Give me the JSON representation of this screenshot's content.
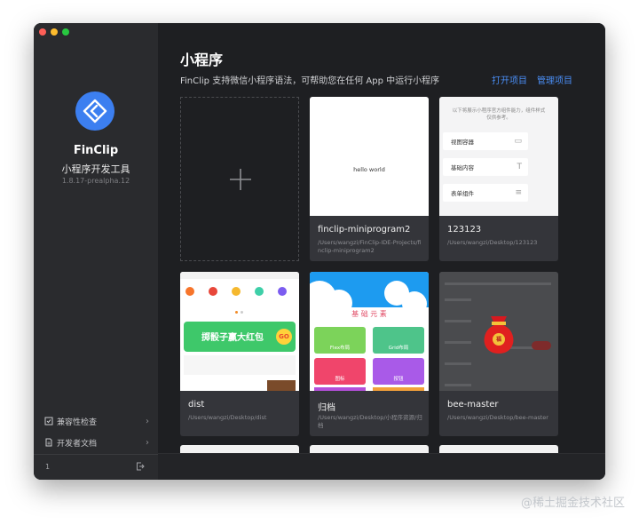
{
  "sidebar": {
    "app_name": "FinClip",
    "app_subtitle": "小程序开发工具",
    "version": "1.8.17-prealpha.12",
    "links": [
      {
        "label": "兼容性检查"
      },
      {
        "label": "开发者文档"
      }
    ],
    "footer_number": "1"
  },
  "header": {
    "title": "小程序",
    "description": "FinClip 支持微信小程序语法，可帮助您在任何 App 中运行小程序",
    "open_project": "打开项目",
    "manage_projects": "管理项目"
  },
  "projects": [
    {
      "name": "finclip-miniprogram2",
      "path": "/Users/wangzi/FinClip-IDE-Projects/finclip-miniprogram2",
      "preview_text": "hello world"
    },
    {
      "name": "123123",
      "path": "/Users/wangzi/Desktop/123123",
      "preview_intro": "以下将展示小程序官方组件能力，组件样式仅供参考。",
      "preview_menu": [
        "视图容器",
        "基础内容",
        "表单组件"
      ]
    },
    {
      "name": "dist",
      "path": "/Users/wangzi/Desktop/dist",
      "banner_text": "掷骰子赢大红包",
      "banner_badge": "GO"
    },
    {
      "name": "归档",
      "path": "/Users/wangzi/Desktop/小程序资源/归档",
      "preview_heading": "基 础 元 素",
      "preview_cells": [
        "Flex布局",
        "Grid布局",
        "图标",
        "按钮"
      ]
    },
    {
      "name": "bee-master",
      "path": "/Users/wangzi/Desktop/bee-master",
      "bag_label": "福"
    }
  ],
  "colors": {
    "window_bg": "#1e1f22",
    "sidebar_bg": "#2a2b2e",
    "card_bg": "#34353a",
    "accent": "#4a8ef5",
    "logo": "#3c7ff0",
    "traffic_close": "#fe5f57",
    "traffic_min": "#febc2e",
    "traffic_max": "#28c840"
  },
  "watermark": "@稀土掘金技术社区"
}
